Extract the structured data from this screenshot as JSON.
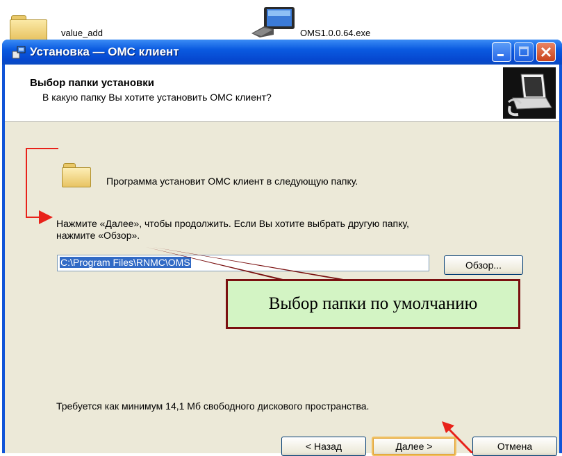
{
  "desktop": {
    "item1_label": "value_add",
    "item2_label": "OMS1.0.0.64.exe"
  },
  "window": {
    "title": "Установка — ОМС клиент"
  },
  "header": {
    "title": "Выбор папки установки",
    "subtitle": "В какую папку Вы хотите установить ОМС клиент?"
  },
  "body": {
    "info": "Программа установит ОМС клиент в следующую папку.",
    "instruction_line1": "Нажмите «Далее», чтобы продолжить. Если Вы хотите выбрать другую папку,",
    "instruction_line2": "нажмите «Обзор».",
    "path_value": "C:\\Program Files\\RNMC\\OMS",
    "browse_label": "Обзор...",
    "space_required": "Требуется как минимум 14,1 Мб свободного дискового пространства."
  },
  "buttons": {
    "back": "< Назад",
    "next": "Далее >",
    "cancel": "Отмена"
  },
  "annotation": {
    "callout_text": "Выбор папки по умолчанию"
  },
  "colors": {
    "callout_bg": "#d3f4c4",
    "callout_border": "#7a1010",
    "arrow_red": "#e8221a",
    "arrow_dark": "#7a1010",
    "xp_blue": "#0a5ae0"
  }
}
